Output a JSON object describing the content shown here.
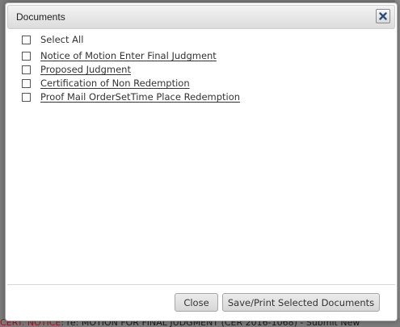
{
  "dialog": {
    "title": "Documents",
    "close_icon": "close-x-icon",
    "select_all_label": "Select All",
    "documents": [
      {
        "label": "Notice of Motion Enter Final Judgment"
      },
      {
        "label": "Proposed Judgment"
      },
      {
        "label": "Certification of Non Redemption"
      },
      {
        "label": "Proof Mail OrderSetTime Place Redemption"
      }
    ],
    "buttons": {
      "close": "Close",
      "save_print": "Save/Print Selected Documents"
    }
  },
  "background": {
    "bottom_text_red": "CERT. NOTICE",
    "bottom_text_rest": ": re: MOTION FOR FINAL JUDGMENT (CER 2016-1068) - Submit New"
  }
}
